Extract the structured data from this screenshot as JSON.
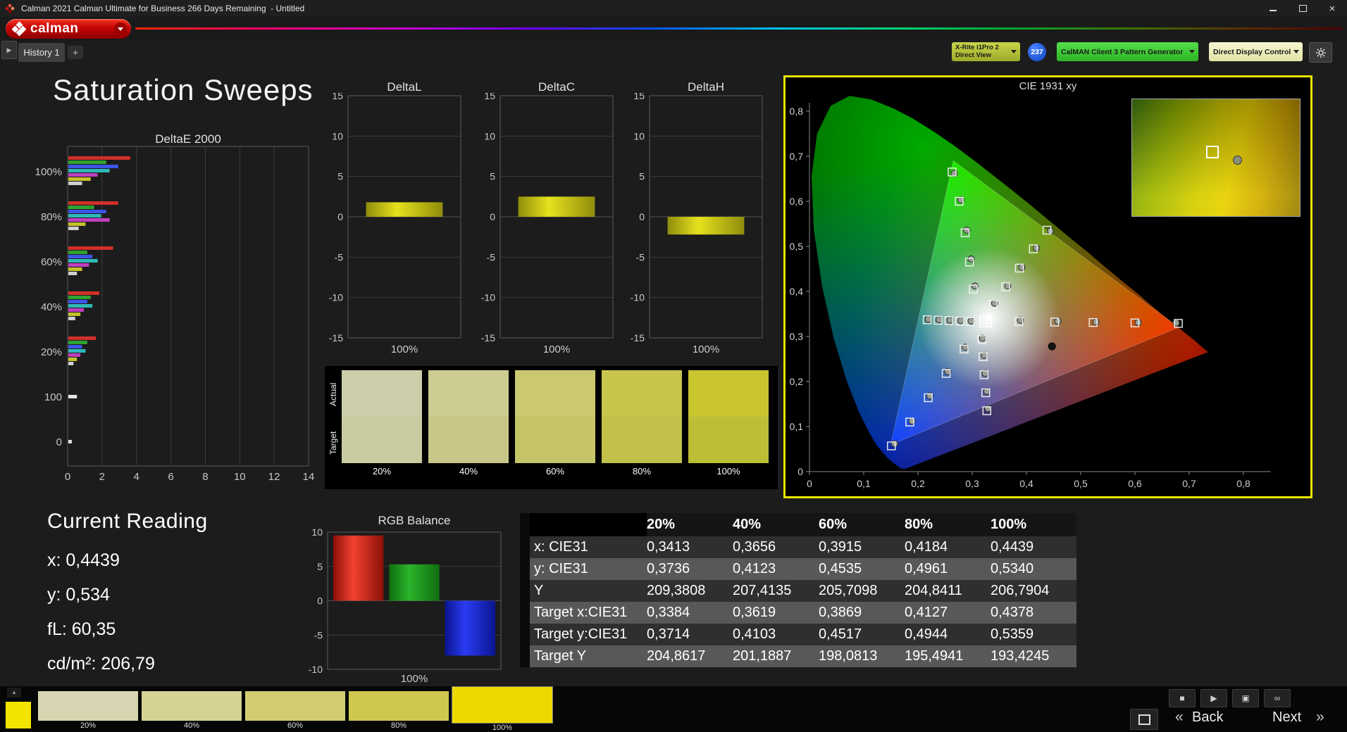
{
  "title_bar": {
    "title": "Calman 2021 Calman Ultimate for Business 266 Days Remaining  - Untitled"
  },
  "toolbar": {
    "logo_text": "calman",
    "meter_line1": "X-Rite i1Pro 2",
    "meter_line2": "Direct View",
    "badge": "237",
    "pattern_generator": "CalMAN Client 3 Pattern Generator",
    "display_control": "Direct Display Control"
  },
  "tabs": {
    "history": "History 1",
    "add": "+"
  },
  "page": {
    "title": "Saturation Sweeps"
  },
  "current_reading": {
    "title": "Current Reading",
    "x": "x: 0,4439",
    "y": "y: 0,534",
    "fl": "fL: 60,35",
    "cdm2": "cd/m²: 206,79"
  },
  "swatch_panel": {
    "actual_label": "Actual",
    "target_label": "Target",
    "swatches": [
      {
        "label": "20%",
        "actual": "#cdcdaa",
        "target": "#cbcba1"
      },
      {
        "label": "40%",
        "actual": "#cccb91",
        "target": "#c8c789"
      },
      {
        "label": "60%",
        "actual": "#cbc970",
        "target": "#c5c468"
      },
      {
        "label": "80%",
        "actual": "#c8c54d",
        "target": "#c1c049"
      },
      {
        "label": "100%",
        "actual": "#c9c52e",
        "target": "#bcbe36"
      }
    ]
  },
  "table": {
    "headers": [
      "20%",
      "40%",
      "60%",
      "80%",
      "100%"
    ],
    "rows": [
      {
        "label": "x: CIE31",
        "values": [
          "0,3413",
          "0,3656",
          "0,3915",
          "0,4184",
          "0,4439"
        ]
      },
      {
        "label": "y: CIE31",
        "values": [
          "0,3736",
          "0,4123",
          "0,4535",
          "0,4961",
          "0,5340"
        ]
      },
      {
        "label": "Y",
        "values": [
          "209,3808",
          "207,4135",
          "205,7098",
          "204,8411",
          "206,7904"
        ]
      },
      {
        "label": "Target x:CIE31",
        "values": [
          "0,3384",
          "0,3619",
          "0,3869",
          "0,4127",
          "0,4378"
        ]
      },
      {
        "label": "Target y:CIE31",
        "values": [
          "0,3714",
          "0,4103",
          "0,4517",
          "0,4944",
          "0,5359"
        ]
      },
      {
        "label": "Target Y",
        "values": [
          "204,8617",
          "201,1887",
          "198,0813",
          "195,4941",
          "193,4245"
        ]
      }
    ]
  },
  "bottom_bar": {
    "chip_color": "#f2e400",
    "back_chev": "«",
    "back": "Back",
    "next": "Next",
    "next_chev": "»",
    "up_glyph": "▲",
    "swatches": [
      {
        "label": "20%",
        "color": "#d8d6b2"
      },
      {
        "label": "40%",
        "color": "#d6d295"
      },
      {
        "label": "60%",
        "color": "#d2cd72"
      },
      {
        "label": "80%",
        "color": "#cfc850"
      },
      {
        "label": "100%",
        "color": "#ecd900",
        "selected": true
      }
    ],
    "buttons": [
      {
        "name": "stop",
        "glyph": "■"
      },
      {
        "name": "play",
        "glyph": "▶"
      },
      {
        "name": "capture",
        "glyph": "▣"
      },
      {
        "name": "loop",
        "glyph": "∞"
      }
    ]
  },
  "charts": {
    "deltae": {
      "title": "DeltaE 2000",
      "xmax": 14,
      "xticks": [
        0,
        2,
        4,
        6,
        8,
        10,
        12,
        14
      ],
      "bar_colors": [
        "#d03028",
        "#2fa32f",
        "#3b55e6",
        "#2fb9b9",
        "#bf3fbf",
        "#c6c12a",
        "#cfcfcf"
      ],
      "groups": [
        {
          "label": "100%",
          "values": [
            3.6,
            2.2,
            2.9,
            2.4,
            1.7,
            1.3,
            0.8
          ]
        },
        {
          "label": "80%",
          "values": [
            2.9,
            1.5,
            2.2,
            1.9,
            2.4,
            1.0,
            0.6
          ]
        },
        {
          "label": "60%",
          "values": [
            2.6,
            1.1,
            1.4,
            1.7,
            1.2,
            0.8,
            0.5
          ]
        },
        {
          "label": "40%",
          "values": [
            1.8,
            1.3,
            1.1,
            1.4,
            0.9,
            0.7,
            0.4
          ]
        },
        {
          "label": "20%",
          "values": [
            1.6,
            1.1,
            0.8,
            1.0,
            0.7,
            0.5,
            0.3
          ]
        },
        {
          "label": "100",
          "values": [
            0.5
          ],
          "color": "#e6e6e6"
        },
        {
          "label": "0",
          "values": [
            0.2
          ],
          "color": "#e6e6e6"
        }
      ]
    },
    "deltaL": {
      "title": "DeltaL",
      "xlabel": "100%",
      "min": -15,
      "max": 15,
      "step": 5,
      "value": 1.8
    },
    "deltaC": {
      "title": "DeltaC",
      "xlabel": "100%",
      "min": -15,
      "max": 15,
      "step": 5,
      "value": 2.5
    },
    "deltaH": {
      "title": "DeltaH",
      "xlabel": "100%",
      "min": -15,
      "max": 15,
      "step": 5,
      "value": -2.2
    },
    "rgb": {
      "title": "RGB Balance",
      "xlabel": "100%",
      "min": -10,
      "max": 10,
      "step": 5,
      "bars": [
        {
          "value": 9.5,
          "light": "#f24130",
          "dark": "#8c1008"
        },
        {
          "value": 5.3,
          "light": "#2cb42c",
          "dark": "#0f6e0f"
        },
        {
          "value": -8.0,
          "light": "#2a3cf2",
          "dark": "#0a1490"
        }
      ]
    },
    "cie": {
      "title": "CIE 1931 xy",
      "xtick_labels": [
        "0",
        "0,1",
        "0,2",
        "0,3",
        "0,4",
        "0,5",
        "0,6",
        "0,7",
        "0,8"
      ],
      "ytick_labels": [
        "0",
        "0,1",
        "0,2",
        "0,3",
        "0,4",
        "0,5",
        "0,6",
        "0,7",
        "0,8"
      ],
      "locus": [
        [
          0.1741,
          0.005
        ],
        [
          0.166,
          0.009
        ],
        [
          0.156,
          0.018
        ],
        [
          0.144,
          0.03
        ],
        [
          0.124,
          0.058
        ],
        [
          0.11,
          0.087
        ],
        [
          0.091,
          0.133
        ],
        [
          0.069,
          0.2
        ],
        [
          0.045,
          0.295
        ],
        [
          0.023,
          0.413
        ],
        [
          0.008,
          0.538
        ],
        [
          0.004,
          0.655
        ],
        [
          0.014,
          0.75
        ],
        [
          0.039,
          0.812
        ],
        [
          0.074,
          0.834
        ],
        [
          0.114,
          0.826
        ],
        [
          0.155,
          0.806
        ],
        [
          0.193,
          0.782
        ],
        [
          0.23,
          0.754
        ],
        [
          0.266,
          0.724
        ],
        [
          0.302,
          0.692
        ],
        [
          0.337,
          0.659
        ],
        [
          0.373,
          0.625
        ],
        [
          0.409,
          0.59
        ],
        [
          0.444,
          0.555
        ],
        [
          0.479,
          0.52
        ],
        [
          0.513,
          0.487
        ],
        [
          0.545,
          0.454
        ],
        [
          0.575,
          0.424
        ],
        [
          0.603,
          0.397
        ],
        [
          0.627,
          0.372
        ],
        [
          0.648,
          0.351
        ],
        [
          0.666,
          0.334
        ],
        [
          0.68,
          0.32
        ],
        [
          0.692,
          0.308
        ],
        [
          0.709,
          0.292
        ],
        [
          0.719,
          0.281
        ],
        [
          0.727,
          0.273
        ],
        [
          0.7347,
          0.2653
        ]
      ],
      "gamut": [
        [
          0.68,
          0.32
        ],
        [
          0.265,
          0.69
        ],
        [
          0.15,
          0.06
        ]
      ],
      "targets": [
        [
          0.386,
          0.333
        ],
        [
          0.452,
          0.332
        ],
        [
          0.523,
          0.331
        ],
        [
          0.6,
          0.33
        ],
        [
          0.68,
          0.329
        ],
        [
          0.302,
          0.405
        ],
        [
          0.295,
          0.465
        ],
        [
          0.287,
          0.53
        ],
        [
          0.276,
          0.6
        ],
        [
          0.263,
          0.665
        ],
        [
          0.285,
          0.272
        ],
        [
          0.252,
          0.218
        ],
        [
          0.219,
          0.164
        ],
        [
          0.185,
          0.11
        ],
        [
          0.151,
          0.057
        ],
        [
          0.296,
          0.333
        ],
        [
          0.277,
          0.334
        ],
        [
          0.257,
          0.335
        ],
        [
          0.237,
          0.336
        ],
        [
          0.217,
          0.337
        ],
        [
          0.318,
          0.293
        ],
        [
          0.32,
          0.255
        ],
        [
          0.322,
          0.215
        ],
        [
          0.325,
          0.175
        ],
        [
          0.327,
          0.135
        ],
        [
          0.3384,
          0.3714
        ],
        [
          0.3619,
          0.4103
        ],
        [
          0.3869,
          0.4517
        ],
        [
          0.4127,
          0.4944
        ],
        [
          0.4378,
          0.5359
        ]
      ],
      "measured": [
        [
          0.389,
          0.336
        ],
        [
          0.458,
          0.334
        ],
        [
          0.528,
          0.332
        ],
        [
          0.606,
          0.331
        ],
        [
          0.676,
          0.33
        ],
        [
          0.305,
          0.412
        ],
        [
          0.298,
          0.472
        ],
        [
          0.29,
          0.536
        ],
        [
          0.279,
          0.603
        ],
        [
          0.267,
          0.662
        ],
        [
          0.287,
          0.276
        ],
        [
          0.255,
          0.222
        ],
        [
          0.222,
          0.168
        ],
        [
          0.189,
          0.112
        ],
        [
          0.157,
          0.062
        ],
        [
          0.298,
          0.334
        ],
        [
          0.279,
          0.335
        ],
        [
          0.259,
          0.336
        ],
        [
          0.239,
          0.337
        ],
        [
          0.219,
          0.338
        ],
        [
          0.319,
          0.296
        ],
        [
          0.322,
          0.258
        ],
        [
          0.324,
          0.218
        ],
        [
          0.327,
          0.178
        ],
        [
          0.329,
          0.14
        ],
        [
          0.3413,
          0.3736
        ],
        [
          0.3656,
          0.4123
        ],
        [
          0.3915,
          0.4535
        ],
        [
          0.4184,
          0.4961
        ],
        [
          0.4439,
          0.534
        ]
      ],
      "current": [
        0.3245,
        0.334
      ],
      "dark_point": [
        0.447,
        0.278
      ]
    }
  }
}
